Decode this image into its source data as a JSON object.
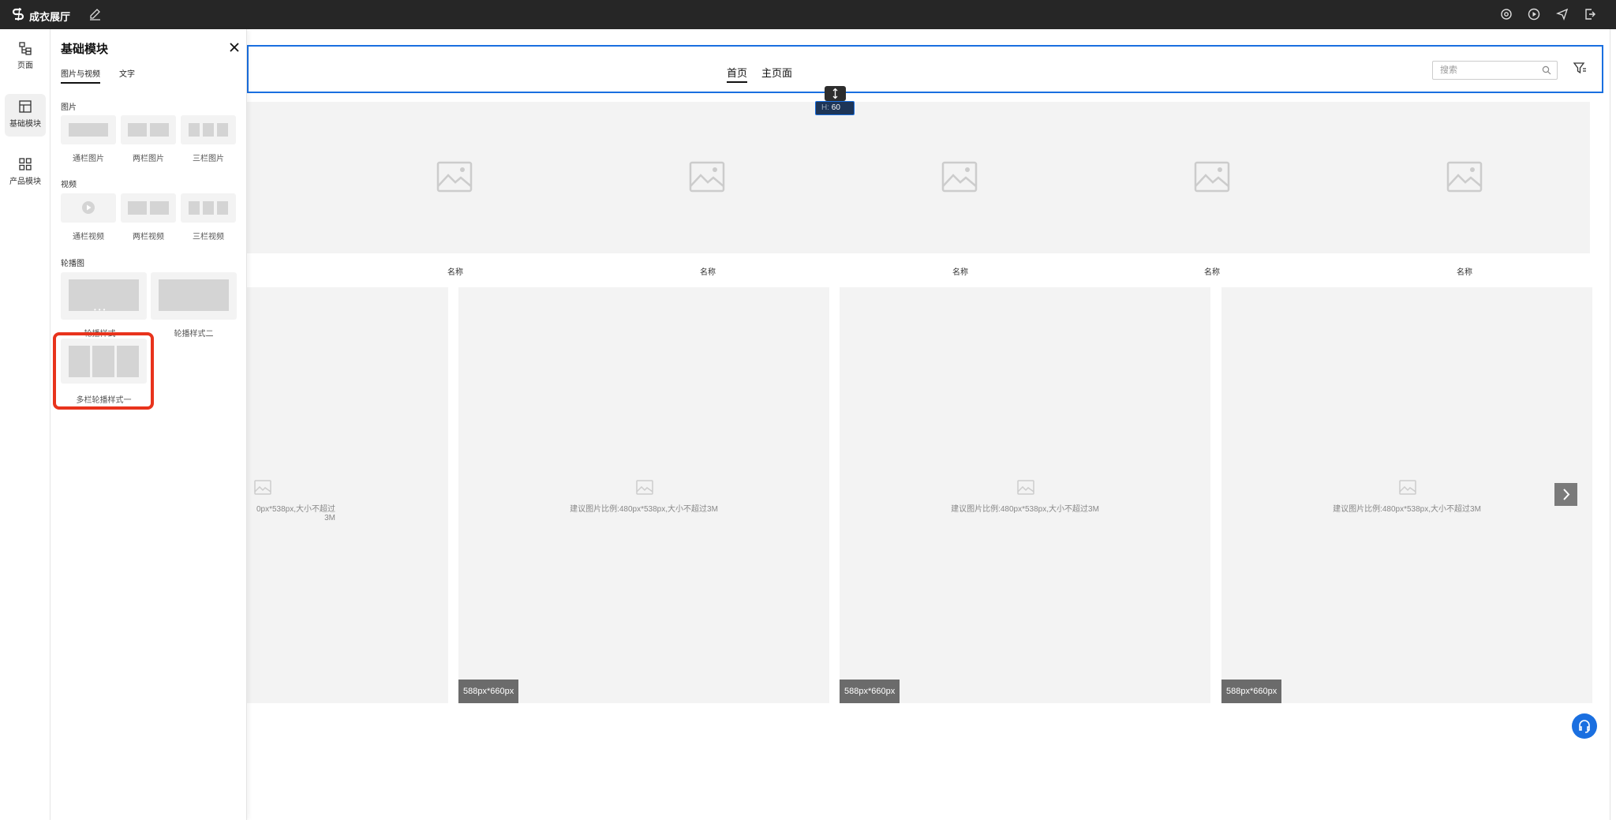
{
  "app": {
    "name": "成衣展厅"
  },
  "panel": {
    "title": "基础模块",
    "tabs": [
      {
        "label": "图片与视频"
      },
      {
        "label": "文字"
      }
    ],
    "sections": {
      "image": {
        "label": "图片",
        "items": [
          {
            "label": "通栏图片"
          },
          {
            "label": "两栏图片"
          },
          {
            "label": "三栏图片"
          }
        ]
      },
      "video": {
        "label": "视频",
        "items": [
          {
            "label": "通栏视频"
          },
          {
            "label": "两栏视频"
          },
          {
            "label": "三栏视频"
          }
        ]
      },
      "carousel": {
        "label": "轮播图",
        "items": [
          {
            "label": "轮播样式一"
          },
          {
            "label": "轮播样式二"
          },
          {
            "label": "多栏轮播样式一"
          }
        ]
      }
    }
  },
  "leftnav": {
    "items": [
      {
        "label": "页面"
      },
      {
        "label": "基础模块"
      },
      {
        "label": "产品模块"
      }
    ]
  },
  "header": {
    "nav": [
      {
        "label": "首页"
      },
      {
        "label": "主页面"
      }
    ],
    "search_placeholder": "搜索",
    "height_key": "H:",
    "height_value": "60"
  },
  "banner": {
    "captions": [
      "名称",
      "名称",
      "名称",
      "名称",
      "名称"
    ]
  },
  "cards": [
    {
      "hint": "建议图片比例:480px*538px,大小不超过3M",
      "size": "588px*660px"
    },
    {
      "hint": "建议图片比例:480px*538px,大小不超过3M",
      "size": "588px*660px"
    },
    {
      "hint": "建议图片比例:480px*538px,大小不超过3M",
      "size": "588px*660px"
    },
    {
      "hint": "建议图片比例:480px*538px,大小不超过3M",
      "size": "588px*660px"
    }
  ],
  "partial_card_hint": "0px*538px,大小不超过3M",
  "colors": {
    "topbar": "#262626",
    "accent": "#1a6fe0",
    "highlight": "#e8331c"
  }
}
